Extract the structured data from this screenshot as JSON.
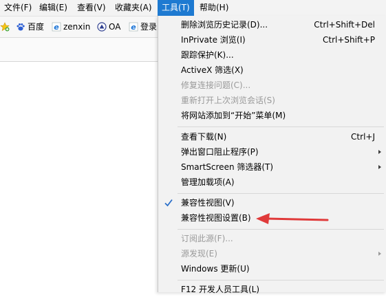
{
  "menubar": {
    "items": [
      {
        "label": "文件(F)"
      },
      {
        "label": "编辑(E)"
      },
      {
        "label": "查看(V)"
      },
      {
        "label": "收藏夹(A)"
      },
      {
        "label": "工具(T)"
      },
      {
        "label": "帮助(H)"
      }
    ],
    "active_index": 4
  },
  "favorites": [
    {
      "label": "",
      "icon": "star-icon"
    },
    {
      "label": "百度",
      "icon": "baidu-paw-icon"
    },
    {
      "label": "zenxin",
      "icon": "ie-icon"
    },
    {
      "label": "OA",
      "icon": "oa-logo-icon"
    },
    {
      "label": "登录",
      "icon": "ie-icon"
    }
  ],
  "tools_menu": {
    "groups": [
      [
        {
          "label": "删除浏览历史记录(D)...",
          "shortcut": "Ctrl+Shift+Del",
          "enabled": true
        },
        {
          "label": "InPrivate 浏览(I)",
          "shortcut": "Ctrl+Shift+P",
          "enabled": true
        },
        {
          "label": "跟踪保护(K)...",
          "shortcut": "",
          "enabled": true
        },
        {
          "label": "ActiveX 筛选(X)",
          "shortcut": "",
          "enabled": true
        },
        {
          "label": "修复连接问题(C)...",
          "shortcut": "",
          "enabled": false
        },
        {
          "label": "重新打开上次浏览会话(S)",
          "shortcut": "",
          "enabled": false
        },
        {
          "label": "将网站添加到“开始”菜单(M)",
          "shortcut": "",
          "enabled": true
        }
      ],
      [
        {
          "label": "查看下载(N)",
          "shortcut": "Ctrl+J",
          "enabled": true
        },
        {
          "label": "弹出窗口阻止程序(P)",
          "shortcut": "",
          "enabled": true,
          "submenu": true
        },
        {
          "label": "SmartScreen 筛选器(T)",
          "shortcut": "",
          "enabled": true,
          "submenu": true
        },
        {
          "label": "管理加载项(A)",
          "shortcut": "",
          "enabled": true
        }
      ],
      [
        {
          "label": "兼容性视图(V)",
          "shortcut": "",
          "enabled": true,
          "checked": true
        },
        {
          "label": "兼容性视图设置(B)",
          "shortcut": "",
          "enabled": true
        }
      ],
      [
        {
          "label": "订阅此源(F)...",
          "shortcut": "",
          "enabled": false
        },
        {
          "label": "源发现(E)",
          "shortcut": "",
          "enabled": false,
          "submenu": true
        },
        {
          "label": "Windows 更新(U)",
          "shortcut": "",
          "enabled": true
        }
      ],
      [
        {
          "label": "F12 开发人员工具(L)",
          "shortcut": "",
          "enabled": true
        }
      ]
    ]
  },
  "colors": {
    "menu_highlight": "#1e7ad1",
    "annotation_arrow": "#e03a3a",
    "disabled_text": "#9a9a9a"
  }
}
